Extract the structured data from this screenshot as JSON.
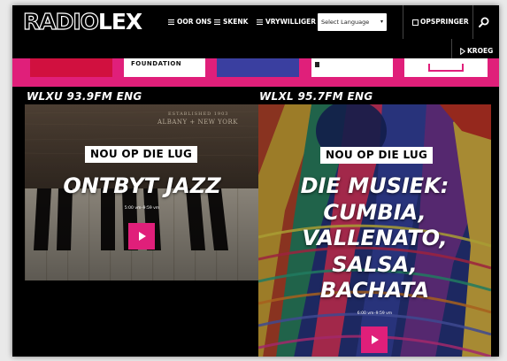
{
  "header": {
    "logo_radio": "RADIO",
    "logo_lex": "LEX",
    "nav": [
      {
        "label": "OOR ONS"
      },
      {
        "label": "SKENK"
      },
      {
        "label": "VRYWILLIGER"
      }
    ],
    "language_select": "Select Language",
    "popout_label": "OPSPRINGER",
    "kroeg_label": "KROEG"
  },
  "promo_band": {
    "tile2_text": "FOUNDATION"
  },
  "stations": [
    {
      "label": "WLXU 93.9FM ENG",
      "badge": "NOU OP DIE LUG",
      "show_title": "ONTBYT JAZZ",
      "show_time": "5:00 vm–9:59 vm",
      "sign_line1": "ESTABLISHED 1903",
      "sign_line2": "ALBANY  +  NEW YORK"
    },
    {
      "label": "WLXL 95.7FM ENG",
      "badge": "NOU OP DIE LUG",
      "show_title_lines": [
        "DIE MUSIEK:",
        "CUMBIA,",
        "VALLENATO,",
        "SALSA,",
        "BACHATA"
      ],
      "show_time": "6:00 vm–9:59 vm"
    }
  ],
  "colors": {
    "accent": "#e01f7a",
    "header_bg": "#000000"
  }
}
